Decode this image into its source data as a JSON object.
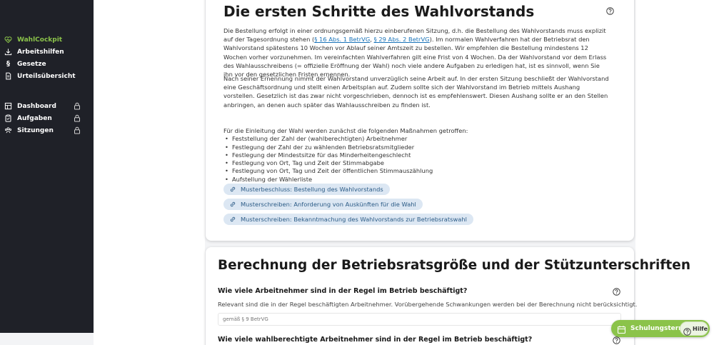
{
  "sidebar": {
    "items": [
      {
        "label": "WahlCockpit",
        "icon": "heartbeat-icon",
        "active": true,
        "locked": false
      },
      {
        "label": "Arbeitshilfen",
        "icon": "download-icon",
        "active": false,
        "locked": false
      },
      {
        "label": "Gesetze",
        "icon": "paragraph-icon",
        "active": false,
        "locked": false
      },
      {
        "label": "Urteilsübersicht",
        "icon": "document-icon",
        "active": false,
        "locked": false
      },
      {
        "label": "Dashboard",
        "icon": "grid-icon",
        "active": false,
        "locked": true
      },
      {
        "label": "Aufgaben",
        "icon": "clipboard-icon",
        "active": false,
        "locked": true
      },
      {
        "label": "Sitzungen",
        "icon": "people-icon",
        "active": false,
        "locked": true
      }
    ]
  },
  "section1": {
    "title": "Die ersten Schritte des Wahlvorstands",
    "p1_a": "Die Bestellung erfolgt in einer ordnungsgemäß hierzu einberufenen Sitzung, d.h. die Bestellung des Wahlvorstands muss explizit auf der Tagesordnung stehen (",
    "link1": "§ 16 Abs. 1 BetrVG",
    "p1_sep": ", ",
    "link2": "§ 29 Abs. 2 BetrVG",
    "p1_b": "). Im normalen Wahlverfahren hat der Betriebsrat den Wahlvorstand spätestens 10 Wochen vor Ablauf seiner Amtszeit zu bestellen. Wir empfehlen die Bestellung mindestens 12 Wochen vorher vorzunehmen. Im vereinfachten Wahlverfahren gilt eine Frist von 4 Wochen. Da der Wahlvorstand vor dem Erlass des Wahlausschreibens (= offizielle Eröffnung der Wahl) noch viele andere Aufgaben zu erledigen hat, ist es sinnvoll, wenn Sie ihn vor den gesetzlichen Fristen ernennen.",
    "p2": "Nach seiner Ernennung nimmt der Wahlvorstand unverzüglich seine Arbeit auf. In der ersten Sitzung beschließt der Wahlvorstand eine Geschäftsordnung und stellt einen Arbeitsplan auf. Zudem sollte sich der Wahlvorstand im Betrieb mittels Aushang vorstellen. Gesetzlich ist das zwar nicht vorgeschrieben, dennoch ist es empfehlenswert. Diesen Aushang sollte er an den Stellen anbringen, an denen auch später das Wahlausschreiben zu finden ist.",
    "list_intro": "Für die Einleitung der Wahl werden zunächst die folgenden Maßnahmen getroffen:",
    "list": [
      "Feststellung der Zahl der (wahlberechtigten) Arbeitnehmer",
      "Festlegung der Zahl der zu wählenden Betriebsratsmitglieder",
      "Festlegung der Mindestsitze für das Minderheitengeschlecht",
      "Festlegung von Ort, Tag und Zeit der Stimmabgabe",
      "Festlegung von Ort, Tag und Zeit der öffentlichen Stimmauszählung",
      "Aufstellung der Wählerliste"
    ],
    "links": [
      "Musterbeschluss: Bestellung des Wahlvorstands",
      "Musterschreiben: Anforderung von Auskünften für die Wahl",
      "Musterschreiben: Bekanntmachung des Wahlvorstands zur Betriebsratswahl"
    ]
  },
  "section2": {
    "title": "Berechnung der Betriebsratsgröße und der Stützunterschriften",
    "q1": "Wie viele Arbeitnehmer sind in der Regel im Betrieb beschäftigt?",
    "q1_desc": "Relevant sind die in der Regel beschäftigten Arbeitnehmer. Vorübergehende Schwankungen werden bei der Berechnung nicht berücksichtigt.",
    "q1_placeholder": "gemäß § 9 BetrVG",
    "q2": "Wie viele wahlberechtigte Arbeitnehmer sind in der Regel im Betrieb beschäftigt?"
  },
  "widgets": {
    "schulung_label": "Schulungstermin",
    "hilfe_label": "Hilfe"
  },
  "colors": {
    "accent": "#8bc34a",
    "sidebar_bg": "#1f2128",
    "link": "#1a73b8",
    "pill_bg": "#dce7f3"
  }
}
